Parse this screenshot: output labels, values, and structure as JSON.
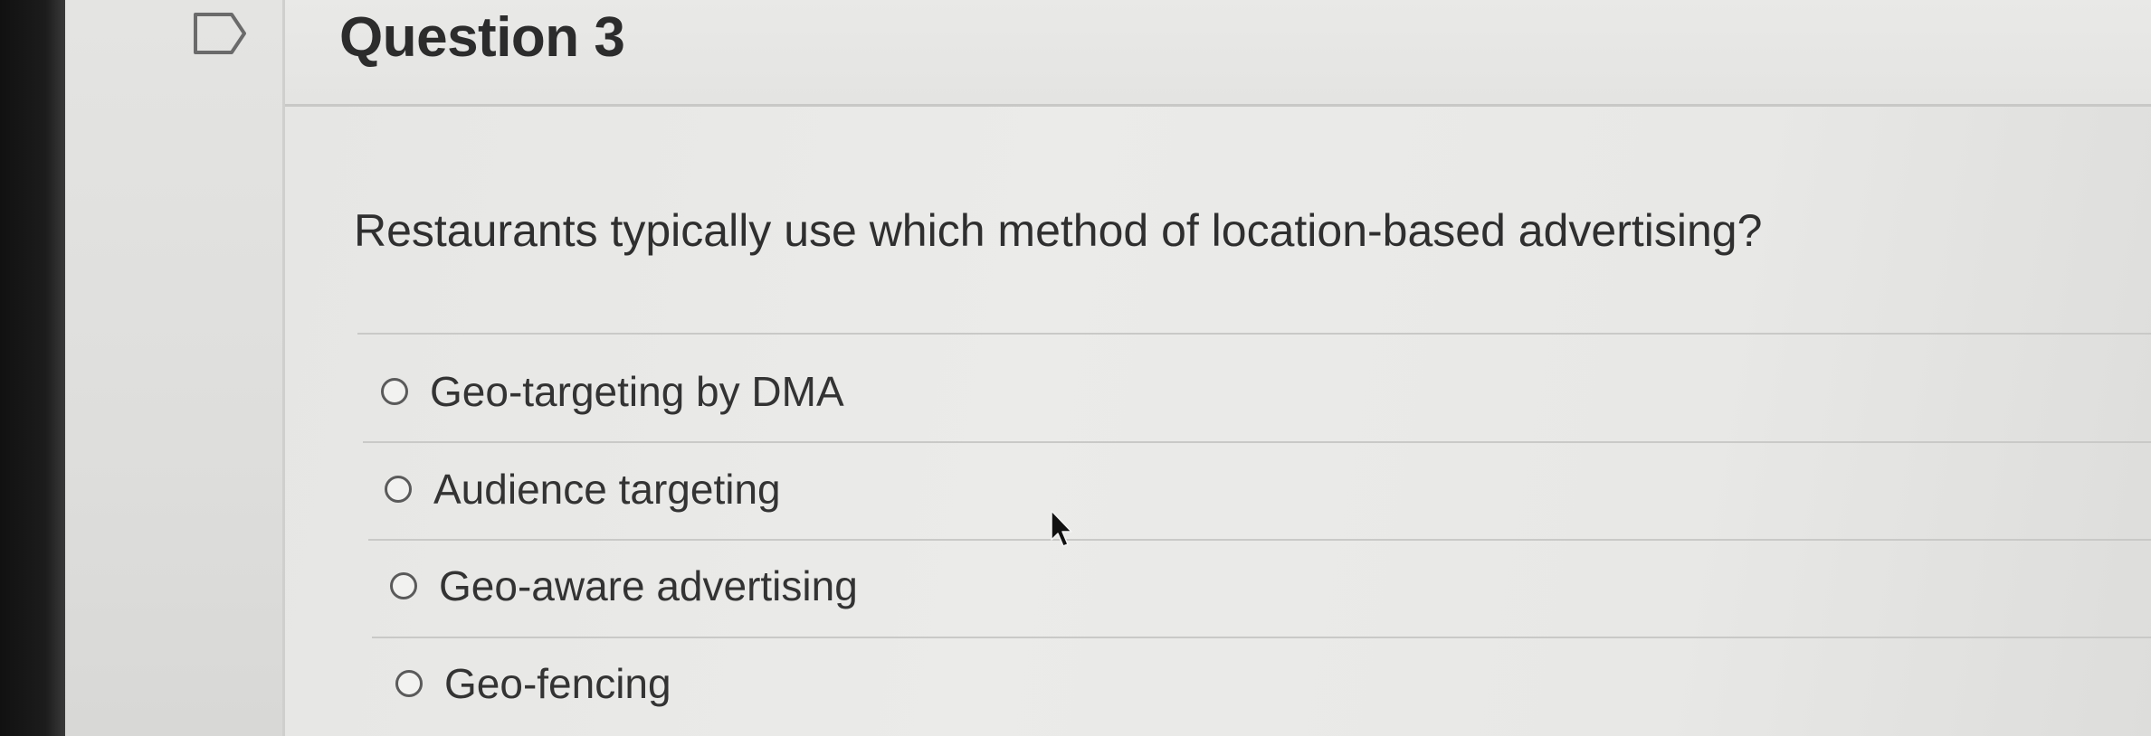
{
  "question": {
    "title": "Question 3",
    "text": "Restaurants typically use which method of location-based advertising?",
    "options": [
      {
        "label": "Geo-targeting by DMA",
        "selected": false
      },
      {
        "label": "Audience targeting",
        "selected": false
      },
      {
        "label": "Geo-aware advertising",
        "selected": false
      },
      {
        "label": "Geo-fencing",
        "selected": false
      }
    ]
  },
  "icons": {
    "flag": "flag-outline-icon",
    "cursor": "mouse-pointer-icon",
    "radio": "radio-button-unselected-icon"
  },
  "colors": {
    "text": "#2f2f2f",
    "background": "#e8e8e6",
    "divider": "#c9c9c7"
  }
}
